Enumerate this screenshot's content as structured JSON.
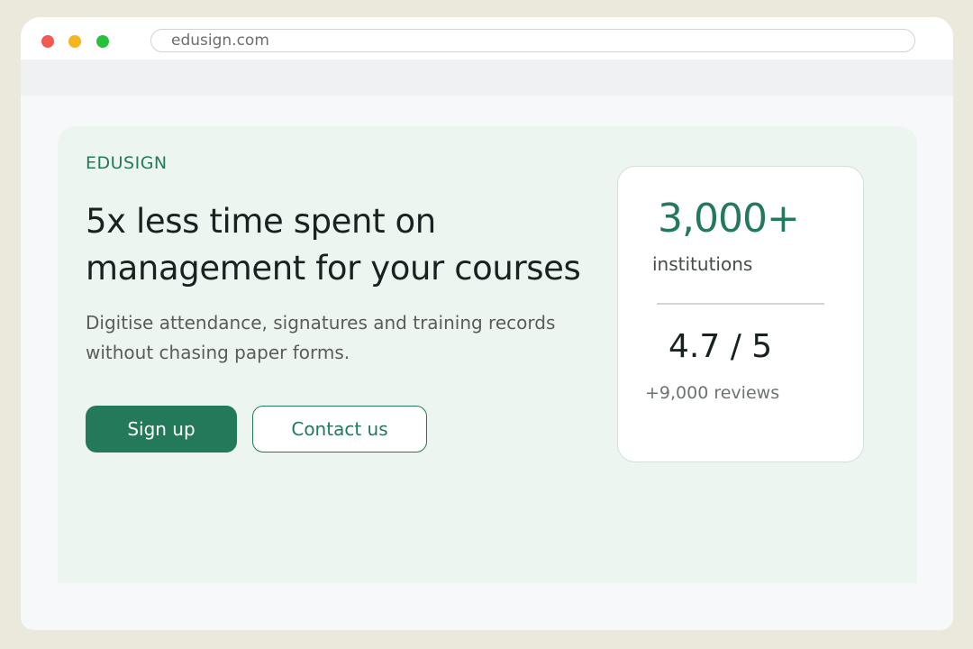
{
  "browser": {
    "url": "edusign.com"
  },
  "hero": {
    "brand": "EDUSIGN",
    "headline_line1": "5x less time spent on",
    "headline_line2": "management for your courses",
    "sub_line1": "Digitise attendance, signatures and training records",
    "sub_line2": "without chasing paper forms.",
    "primary_button": "Sign up",
    "secondary_button": "Contact us"
  },
  "stats": {
    "institutions_value": "3,000+",
    "institutions_label": "institutions",
    "rating_value": "4.7 / 5",
    "reviews_label": "+9,000 reviews"
  },
  "colors": {
    "accent": "#237a5a",
    "hero_background": "#edf5f1",
    "page_background": "#ebe8dc"
  },
  "icons": [
    "close-window-dot",
    "minimize-window-dot",
    "maximize-window-dot"
  ]
}
